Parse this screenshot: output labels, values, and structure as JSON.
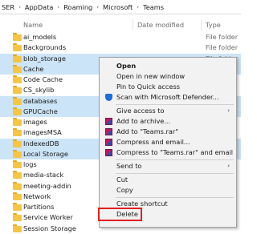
{
  "breadcrumb": [
    "SER",
    "AppData",
    "Roaming",
    "Microsoft",
    "Teams"
  ],
  "columns": {
    "name": "Name",
    "date_modified": "Date modified",
    "type": "Type"
  },
  "files": [
    {
      "name": "ai_models",
      "date": "",
      "type": "File folder",
      "selected": false
    },
    {
      "name": "Backgrounds",
      "date": "",
      "type": "File folder",
      "selected": false
    },
    {
      "name": "blob_storage",
      "date": "",
      "type": "File folder",
      "selected": true
    },
    {
      "name": "Cache",
      "date": "",
      "type": "",
      "selected": true
    },
    {
      "name": "Code Cache",
      "date": "",
      "type": "",
      "selected": false
    },
    {
      "name": "CS_skylib",
      "date": "",
      "type": "",
      "selected": false
    },
    {
      "name": "databases",
      "date": "",
      "type": "",
      "selected": true
    },
    {
      "name": "GPUCache",
      "date": "",
      "type": "",
      "selected": true
    },
    {
      "name": "images",
      "date": "",
      "type": "",
      "selected": false
    },
    {
      "name": "imagesMSA",
      "date": "",
      "type": "",
      "selected": false
    },
    {
      "name": "IndexedDB",
      "date": "",
      "type": "",
      "selected": true
    },
    {
      "name": "Local Storage",
      "date": "",
      "type": "",
      "selected": true
    },
    {
      "name": "logs",
      "date": "",
      "type": "",
      "selected": false
    },
    {
      "name": "media-stack",
      "date": "",
      "type": "",
      "selected": false
    },
    {
      "name": "meeting-addin",
      "date": "",
      "type": "",
      "selected": false
    },
    {
      "name": "Network",
      "date": "",
      "type": "",
      "selected": false
    },
    {
      "name": "Partitions",
      "date": "",
      "type": "",
      "selected": false
    },
    {
      "name": "Service Worker",
      "date": "",
      "type": "",
      "selected": false
    },
    {
      "name": "Session Storage",
      "date": "",
      "type": "",
      "selected": false
    }
  ],
  "context_menu": {
    "open": "Open",
    "open_new_window": "Open in new window",
    "pin_quick_access": "Pin to Quick access",
    "scan_defender": "Scan with Microsoft Defender...",
    "give_access": "Give access to",
    "add_archive": "Add to archive...",
    "add_teams_rar": "Add to \"Teams.rar\"",
    "compress_email": "Compress and email...",
    "compress_teams_email": "Compress to \"Teams.rar\" and email",
    "send_to": "Send to",
    "cut": "Cut",
    "copy": "Copy",
    "create_shortcut": "Create shortcut",
    "delete": "Delete"
  },
  "colors": {
    "selection": "#cce4f7",
    "folder": "#f5c547",
    "highlight_border": "#e02020"
  }
}
